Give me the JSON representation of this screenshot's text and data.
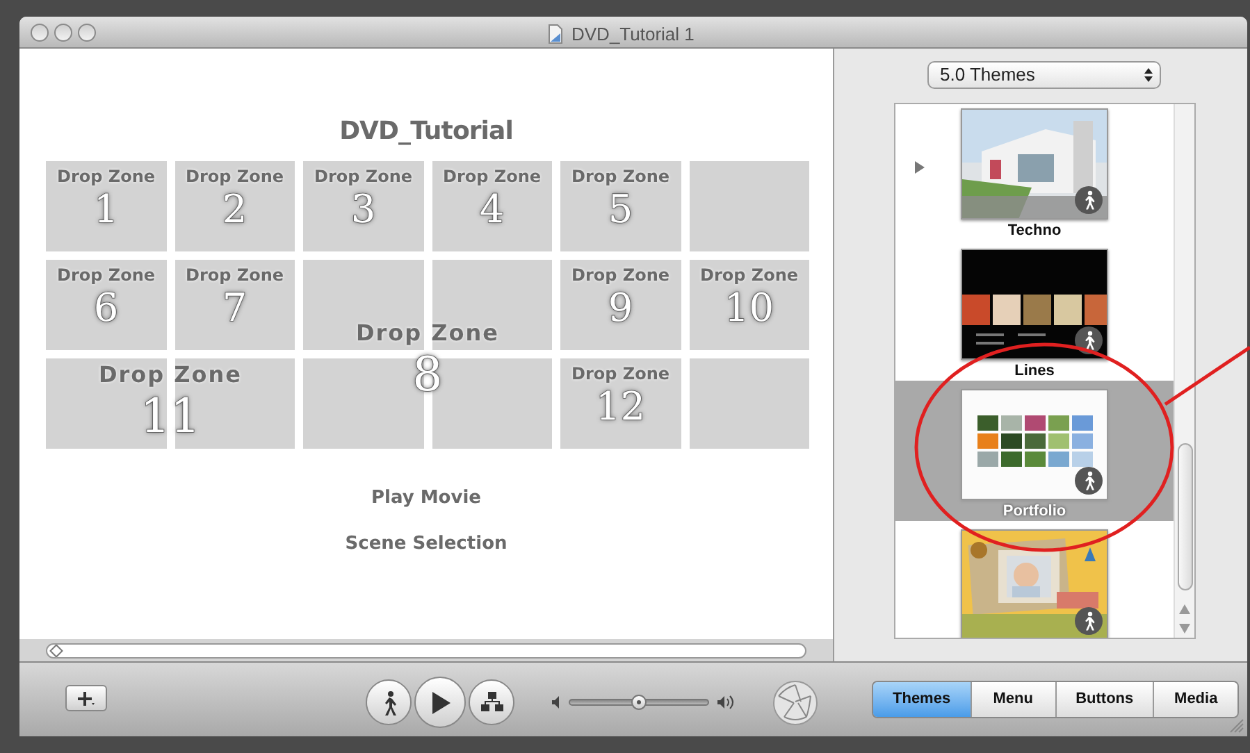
{
  "window": {
    "title": "DVD_Tutorial 1"
  },
  "menu_preview": {
    "title": "DVD_Tutorial",
    "drop_zones": [
      {
        "label": "Drop Zone",
        "number": "1"
      },
      {
        "label": "Drop Zone",
        "number": "2"
      },
      {
        "label": "Drop Zone",
        "number": "3"
      },
      {
        "label": "Drop Zone",
        "number": "4"
      },
      {
        "label": "Drop Zone",
        "number": "5"
      },
      {
        "label": "Drop Zone",
        "number": "6"
      },
      {
        "label": "Drop Zone",
        "number": "7"
      },
      {
        "label": "Drop Zone",
        "number": "8"
      },
      {
        "label": "Drop Zone",
        "number": "9"
      },
      {
        "label": "Drop Zone",
        "number": "10"
      },
      {
        "label": "Drop Zone",
        "number": "11"
      },
      {
        "label": "Drop Zone",
        "number": "12"
      }
    ],
    "menu_buttons": [
      "Play Movie",
      "Scene Selection"
    ]
  },
  "theme_set": {
    "value": "5.0 Themes"
  },
  "themes": [
    {
      "name": "Techno",
      "selected": false
    },
    {
      "name": "Lines",
      "selected": false
    },
    {
      "name": "Portfolio",
      "selected": true
    },
    {
      "selected": false
    }
  ],
  "volume": {
    "level": 0.5
  },
  "tabs": [
    {
      "label": "Themes",
      "selected": true
    },
    {
      "label": "Menu",
      "selected": false
    },
    {
      "label": "Buttons",
      "selected": false
    },
    {
      "label": "Media",
      "selected": false
    }
  ]
}
